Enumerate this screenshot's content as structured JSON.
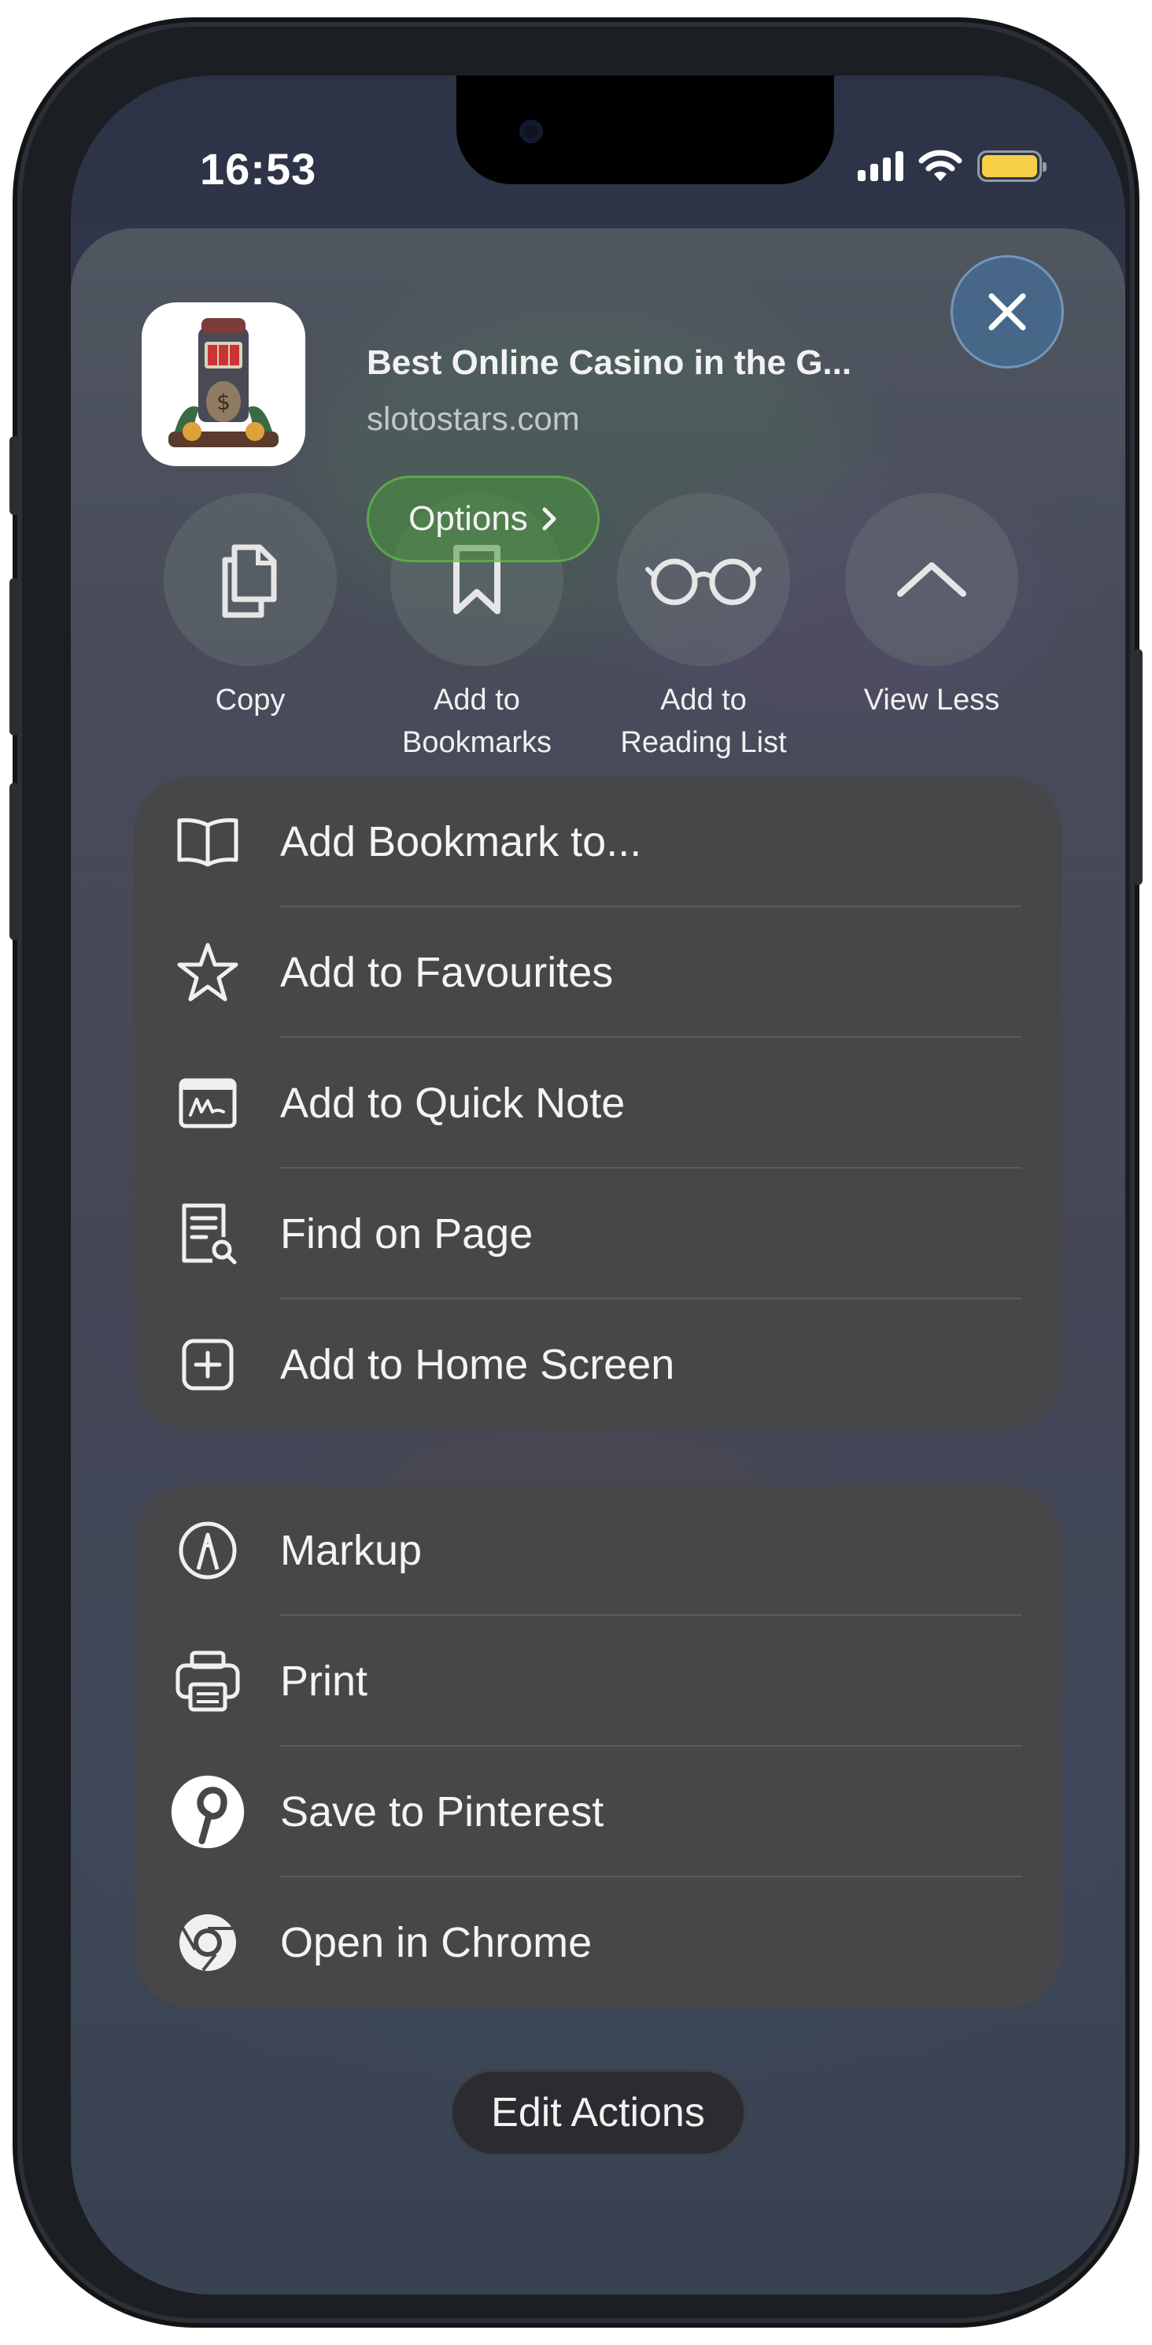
{
  "status_bar": {
    "time": "16:53"
  },
  "share_sheet": {
    "page_title": "Best Online Casino in the G...",
    "domain": "slotostars.com",
    "options_label": "Options",
    "quick_actions": [
      {
        "label": "Copy",
        "icon": "copy-icon"
      },
      {
        "label": "Add to\nBookmarks",
        "icon": "bookmark-icon"
      },
      {
        "label": "Add to\nReading List",
        "icon": "glasses-icon"
      },
      {
        "label": "View Less",
        "icon": "chevron-up-icon"
      }
    ],
    "group1": [
      {
        "label": "Add Bookmark to...",
        "icon": "book-icon"
      },
      {
        "label": "Add to Favourites",
        "icon": "star-icon"
      },
      {
        "label": "Add to Quick Note",
        "icon": "quick-note-icon"
      },
      {
        "label": "Find on Page",
        "icon": "find-on-page-icon"
      },
      {
        "label": "Add to Home Screen",
        "icon": "add-square-icon"
      }
    ],
    "group2": [
      {
        "label": "Markup",
        "icon": "markup-icon"
      },
      {
        "label": "Print",
        "icon": "printer-icon"
      },
      {
        "label": "Save to Pinterest",
        "icon": "pinterest-icon"
      },
      {
        "label": "Open in Chrome",
        "icon": "chrome-icon"
      }
    ],
    "edit_actions_label": "Edit Actions"
  },
  "colors": {
    "battery": "#f6cf47",
    "options_button": "#4a963c",
    "close_button": "#466e96",
    "group_background": "#474749"
  }
}
